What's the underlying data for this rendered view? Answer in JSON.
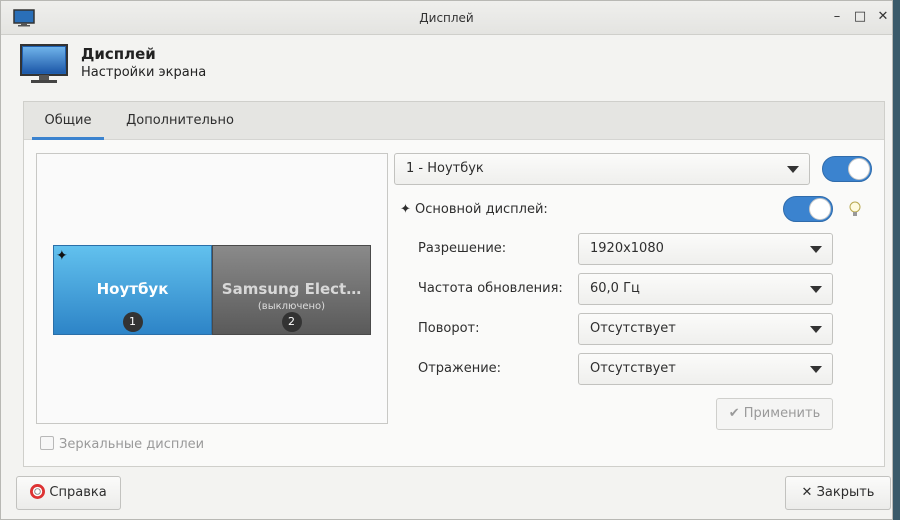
{
  "window": {
    "title": "Дисплей"
  },
  "header": {
    "title": "Дисплей",
    "subtitle": "Настройки экрана"
  },
  "tabs": [
    {
      "label": "Общие",
      "active": true
    },
    {
      "label": "Дополнительно",
      "active": false
    }
  ],
  "preview": {
    "monitors": [
      {
        "name": "Ноутбук",
        "sub": "",
        "number": "1",
        "primary": true
      },
      {
        "name": "Samsung Elect…",
        "sub": "(выключено)",
        "number": "2",
        "primary": false
      }
    ],
    "mirror_label": "Зеркальные дисплеи"
  },
  "output": {
    "selected": "1 - Ноутбук",
    "enabled": true
  },
  "primary": {
    "label": "Основной дисплей:",
    "enabled": true
  },
  "settings": {
    "resolution": {
      "label": "Разрешение:",
      "value": "1920x1080"
    },
    "refresh": {
      "label": "Частота обновления:",
      "value": "60,0 Гц"
    },
    "rotation": {
      "label": "Поворот:",
      "value": "Отсутствует"
    },
    "reflection": {
      "label": "Отражение:",
      "value": "Отсутствует"
    }
  },
  "buttons": {
    "apply": "Применить",
    "help": "Справка",
    "close": "Закрыть"
  },
  "colors": {
    "accent": "#3b83cf"
  }
}
